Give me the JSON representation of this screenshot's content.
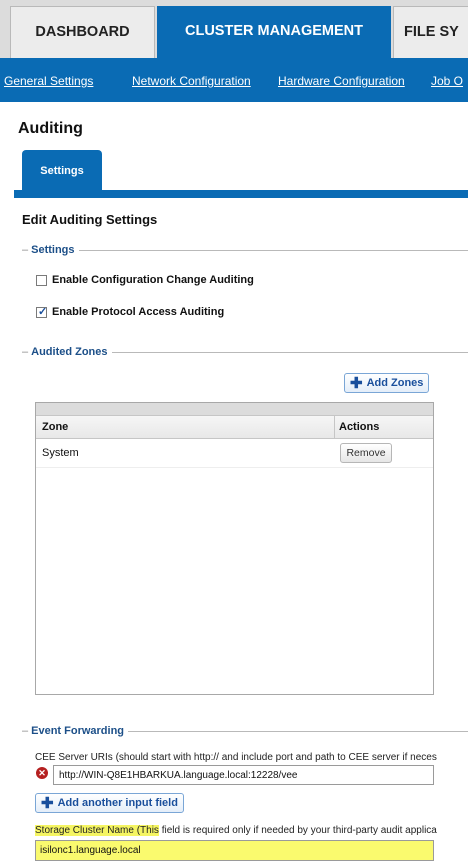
{
  "topnav": {
    "tabs": [
      {
        "label": "DASHBOARD"
      },
      {
        "label": "CLUSTER MANAGEMENT"
      },
      {
        "label": "FILE SY"
      }
    ],
    "active_tab": "CLUSTER MANAGEMENT"
  },
  "subnav": {
    "links": [
      {
        "label": "General Settings"
      },
      {
        "label": "Network Configuration"
      },
      {
        "label": "Hardware Configuration"
      },
      {
        "label": "Job O"
      }
    ]
  },
  "page": {
    "title": "Auditing",
    "tab": "Settings",
    "heading": "Edit Auditing Settings"
  },
  "settings": {
    "legend": "Settings",
    "options": [
      {
        "label": "Enable Configuration Change Auditing",
        "checked": false
      },
      {
        "label": "Enable Protocol Access Auditing",
        "checked": true
      }
    ]
  },
  "audited_zones": {
    "legend": "Audited Zones",
    "add_button": "Add Zones",
    "columns": [
      "Zone",
      "Actions"
    ],
    "rows": [
      {
        "zone": "System",
        "action": "Remove"
      }
    ]
  },
  "event_forwarding": {
    "legend": "Event Forwarding",
    "cee_label": "CEE Server URIs (should start with http:// and include port and path to CEE server if neces",
    "cee_value": "http://WIN-Q8E1HBARKUA.language.local:12228/vee",
    "add_input_button": "Add another input field",
    "storage_label_highlight": "Storage Cluster Name (This",
    "storage_label_rest": " field is required only if needed by your third-party audit applica",
    "storage_value": "isilonc1.language.local"
  },
  "colors": {
    "brand_blue": "#0a6bb4",
    "legend_text": "#1c4f88",
    "highlight": "#f5f562",
    "error_red": "#b52020"
  },
  "icons": {
    "add": "plus-icon",
    "error": "error-x-icon",
    "checkbox": "check-icon"
  }
}
